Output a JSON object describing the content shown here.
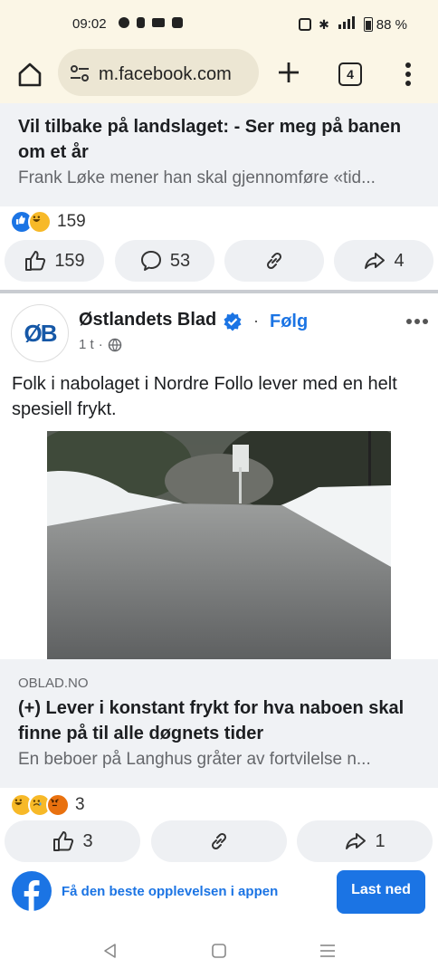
{
  "status_bar": {
    "time": "09:02",
    "battery": "88 %"
  },
  "browser": {
    "url": "m.facebook.com",
    "tab_count": "4"
  },
  "post1": {
    "headline": "Vil tilbake på landslaget: - Ser meg på banen om et år",
    "subtitle": "Frank Løke mener han skal gjennomføre «tid...",
    "reaction_count": "159",
    "like_count": "159",
    "comment_count": "53",
    "share_count": "4"
  },
  "post2": {
    "page_name": "Østlandets Blad",
    "avatar_text": "ØB",
    "follow_label": "Følg",
    "time": "1 t",
    "separator": "·",
    "text": "Folk i nabolaget i Nordre Follo lever med en helt spesiell frykt.",
    "link_domain": "OBLAD.NO",
    "link_headline": "(+) Lever i konstant frykt for hva naboen skal finne på til alle døgnets tider",
    "link_subtitle": "En beboer på Langhus gråter av fortvilelse n...",
    "reaction_count": "3",
    "like_count": "3",
    "share_count": "1"
  },
  "app_banner": {
    "text": "Få den beste opplevelsen i appen",
    "button": "Last ned"
  },
  "colors": {
    "facebook_blue": "#1b74e4",
    "browser_bar": "#fbf6e6"
  }
}
